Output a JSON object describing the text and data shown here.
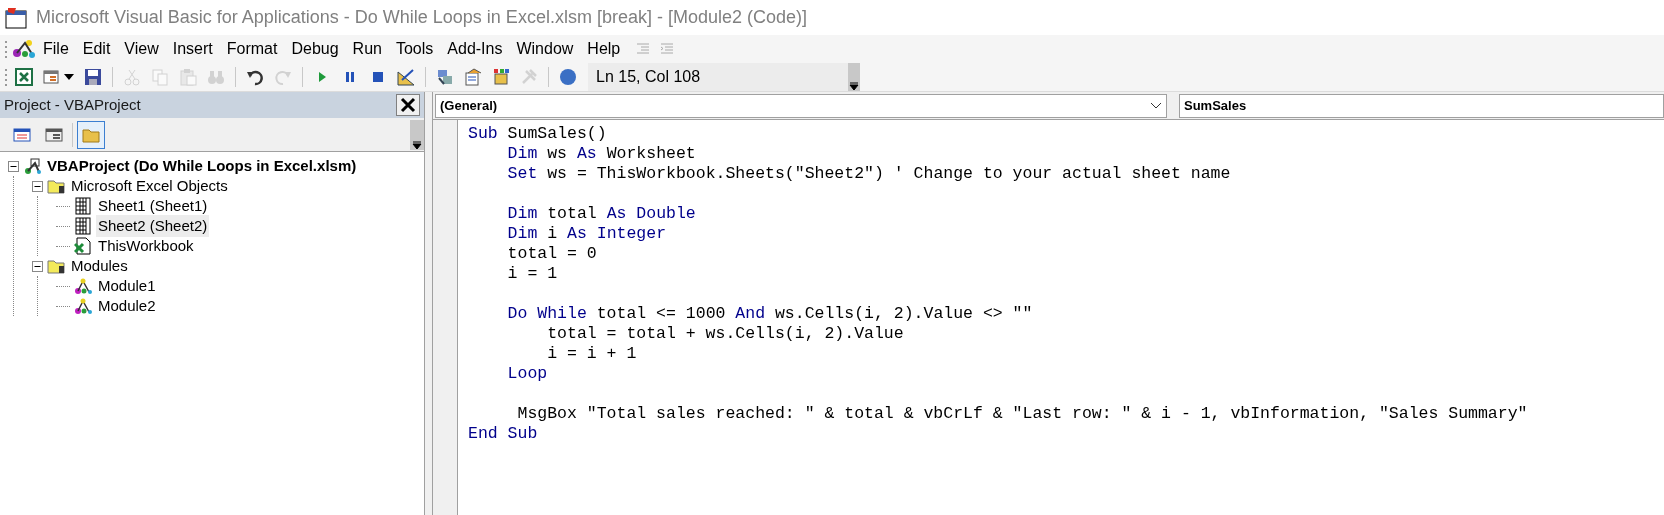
{
  "window": {
    "title": "Microsoft Visual Basic for Applications - Do While Loops in Excel.xlsm [break] - [Module2 (Code)]"
  },
  "menu": [
    "File",
    "Edit",
    "View",
    "Insert",
    "Format",
    "Debug",
    "Run",
    "Tools",
    "Add-Ins",
    "Window",
    "Help"
  ],
  "toolbar": [
    {
      "kind": "excel",
      "disabled": false
    },
    {
      "kind": "insert",
      "disabled": false
    },
    {
      "kind": "save",
      "disabled": false
    },
    {
      "kind": "sep"
    },
    {
      "kind": "cut",
      "disabled": true
    },
    {
      "kind": "copy",
      "disabled": true
    },
    {
      "kind": "paste",
      "disabled": true
    },
    {
      "kind": "find",
      "disabled": true
    },
    {
      "kind": "sep"
    },
    {
      "kind": "undo",
      "disabled": false
    },
    {
      "kind": "redo",
      "disabled": true
    },
    {
      "kind": "sep"
    },
    {
      "kind": "run",
      "disabled": false
    },
    {
      "kind": "pause",
      "disabled": false
    },
    {
      "kind": "stop",
      "disabled": false
    },
    {
      "kind": "design",
      "disabled": false
    },
    {
      "kind": "sep"
    },
    {
      "kind": "project",
      "disabled": false
    },
    {
      "kind": "properties",
      "disabled": false
    },
    {
      "kind": "browser",
      "disabled": false
    },
    {
      "kind": "tools",
      "disabled": true
    },
    {
      "kind": "sep"
    },
    {
      "kind": "help",
      "disabled": false
    }
  ],
  "cursor_position": "Ln 15, Col 108",
  "project_panel": {
    "title": "Project - VBAProject",
    "buttons": [
      {
        "kind": "code",
        "selected": false
      },
      {
        "kind": "object",
        "selected": false
      },
      {
        "kind": "folders",
        "selected": true
      }
    ],
    "tree": [
      {
        "kind": "project",
        "label": "VBAProject (Do While Loops in Excel.xlsm)",
        "selected": false,
        "expanded": true,
        "children": [
          {
            "kind": "folder",
            "label": "Microsoft Excel Objects",
            "selected": false,
            "expanded": true,
            "children": [
              {
                "kind": "sheet",
                "label": "Sheet1 (Sheet1)",
                "selected": false
              },
              {
                "kind": "sheet",
                "label": "Sheet2 (Sheet2)",
                "selected": true
              },
              {
                "kind": "workbook",
                "label": "ThisWorkbook",
                "selected": false
              }
            ]
          },
          {
            "kind": "folder",
            "label": "Modules",
            "selected": false,
            "expanded": true,
            "children": [
              {
                "kind": "module",
                "label": "Module1",
                "selected": false
              },
              {
                "kind": "module",
                "label": "Module2",
                "selected": false
              }
            ]
          }
        ]
      }
    ]
  },
  "code_window": {
    "object_box": "(General)",
    "procedure_box": "SumSales",
    "lines": [
      {
        "kind": "code",
        "tokens": [
          {
            "kind": "keyword",
            "text": "Sub"
          },
          {
            "kind": "plain",
            "text": " SumSales()"
          }
        ],
        "children": [
          {
            "kind": "code",
            "tokens": [
              {
                "kind": "keyword",
                "text": "Dim"
              },
              {
                "kind": "plain",
                "text": " ws "
              },
              {
                "kind": "keyword",
                "text": "As"
              },
              {
                "kind": "plain",
                "text": " Worksheet"
              }
            ]
          },
          {
            "kind": "code",
            "tokens": [
              {
                "kind": "keyword",
                "text": "Set"
              },
              {
                "kind": "plain",
                "text": " ws = ThisWorkbook.Sheets(\"Sheet2\") ' Change to your actual sheet name"
              }
            ]
          },
          {
            "kind": "blank"
          },
          {
            "kind": "code",
            "tokens": [
              {
                "kind": "keyword",
                "text": "Dim"
              },
              {
                "kind": "plain",
                "text": " total "
              },
              {
                "kind": "keyword",
                "text": "As Double"
              }
            ]
          },
          {
            "kind": "code",
            "tokens": [
              {
                "kind": "keyword",
                "text": "Dim"
              },
              {
                "kind": "plain",
                "text": " i "
              },
              {
                "kind": "keyword",
                "text": "As Integer"
              }
            ]
          },
          {
            "kind": "code",
            "tokens": [
              {
                "kind": "plain",
                "text": "total = 0"
              }
            ]
          },
          {
            "kind": "code",
            "tokens": [
              {
                "kind": "plain",
                "text": "i = 1"
              }
            ]
          },
          {
            "kind": "blank"
          },
          {
            "kind": "code",
            "tokens": [
              {
                "kind": "keyword",
                "text": "Do While"
              },
              {
                "kind": "plain",
                "text": " total <= 1000 "
              },
              {
                "kind": "keyword",
                "text": "And"
              },
              {
                "kind": "plain",
                "text": " ws.Cells(i, 2).Value <> \"\""
              }
            ],
            "children": [
              {
                "kind": "code",
                "tokens": [
                  {
                    "kind": "plain",
                    "text": "total = total + ws.Cells(i, 2).Value"
                  }
                ]
              },
              {
                "kind": "code",
                "tokens": [
                  {
                    "kind": "plain",
                    "text": "i = i + 1"
                  }
                ]
              }
            ]
          },
          {
            "kind": "code",
            "tokens": [
              {
                "kind": "keyword",
                "text": "Loop"
              }
            ]
          },
          {
            "kind": "blank"
          },
          {
            "kind": "code",
            "tokens": [
              {
                "kind": "plain",
                "text": " MsgBox \"Total sales reached: \" & total & vbCrLf & \"Last row: \" & i - 1, vbInformation, \"Sales Summary\""
              }
            ]
          }
        ]
      },
      {
        "kind": "code",
        "tokens": [
          {
            "kind": "keyword",
            "text": "End Sub"
          }
        ]
      }
    ]
  }
}
